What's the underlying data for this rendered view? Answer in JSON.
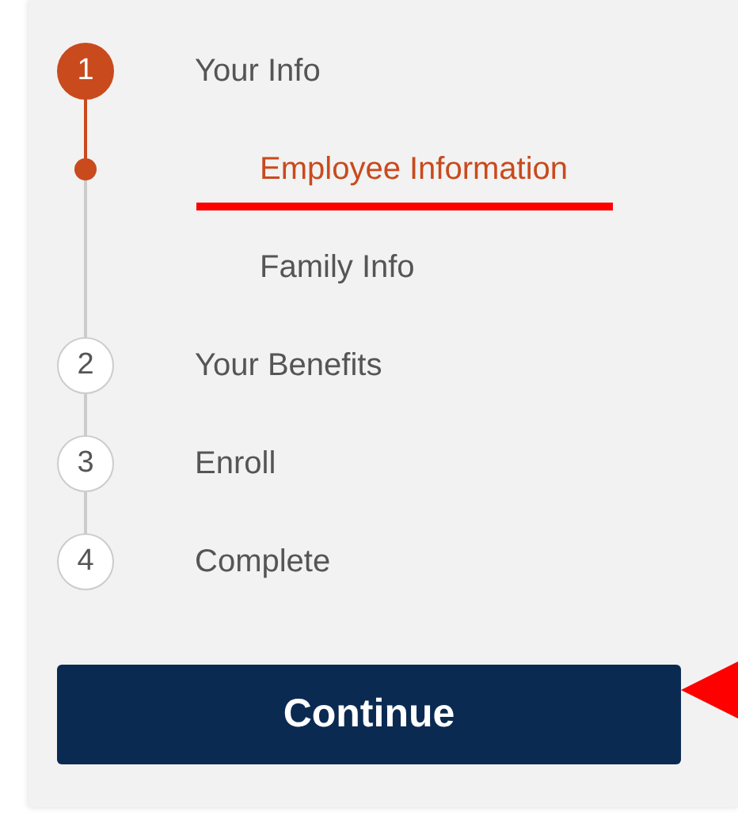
{
  "steps": [
    {
      "number": "1",
      "label": "Your Info",
      "selected": true,
      "children": [
        {
          "label": "Employee Information",
          "selected": true
        },
        {
          "label": "Family Info",
          "selected": false
        }
      ]
    },
    {
      "number": "2",
      "label": "Your Benefits",
      "selected": false
    },
    {
      "number": "3",
      "label": "Enroll",
      "selected": false
    },
    {
      "number": "4",
      "label": "Complete",
      "selected": false
    }
  ],
  "button": {
    "label": "Continue"
  }
}
